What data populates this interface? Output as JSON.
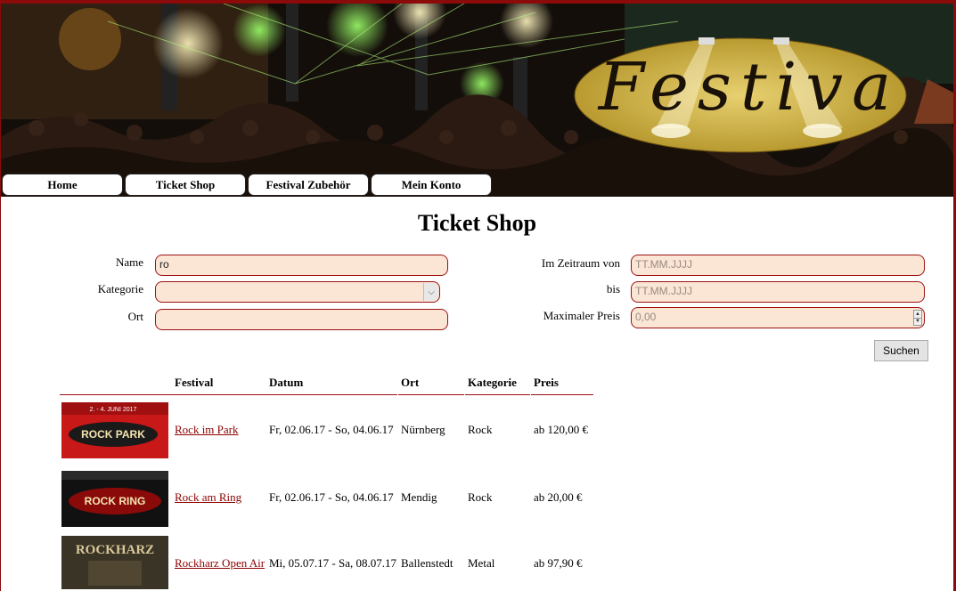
{
  "logo": {
    "text": "Festiva"
  },
  "nav": {
    "items": [
      {
        "label": "Home"
      },
      {
        "label": "Ticket Shop"
      },
      {
        "label": "Festival Zubehör"
      },
      {
        "label": "Mein Konto"
      }
    ]
  },
  "page": {
    "title": "Ticket Shop"
  },
  "search": {
    "name_label": "Name",
    "name_value": "ro",
    "category_label": "Kategorie",
    "category_value": "",
    "location_label": "Ort",
    "location_value": "",
    "date_from_label": "Im Zeitraum von",
    "date_from_placeholder": "TT.MM.JJJJ",
    "date_to_label": "bis",
    "date_to_placeholder": "TT.MM.JJJJ",
    "max_price_label": "Maximaler Preis",
    "max_price_value": "0,00",
    "submit_label": "Suchen"
  },
  "table": {
    "headers": [
      "Festival",
      "Datum",
      "Ort",
      "Kategorie",
      "Preis"
    ],
    "rows": [
      {
        "thumb_text": "ROCK PARK",
        "thumb_top": "2. - 4. JUNI 2017",
        "festival": "Rock im Park",
        "date": "Fr, 02.06.17 - So, 04.06.17",
        "location": "Nürnberg",
        "category": "Rock",
        "price": "ab 120,00 €"
      },
      {
        "thumb_text": "ROCK RING",
        "thumb_top": "",
        "festival": "Rock am Ring",
        "date": "Fr, 02.06.17 - So, 04.06.17",
        "location": "Mendig",
        "category": "Rock",
        "price": "ab 20,00 €"
      },
      {
        "thumb_text": "ROCKHARZ",
        "thumb_top": "",
        "festival": "Rockharz Open Air",
        "date": "Mi, 05.07.17 - Sa, 08.07.17",
        "location": "Ballenstedt",
        "category": "Metal",
        "price": "ab 97,90 €"
      }
    ]
  },
  "colors": {
    "accent": "#9c1010",
    "field_bg": "#fbe6d6",
    "frame": "#8b0a0a"
  }
}
